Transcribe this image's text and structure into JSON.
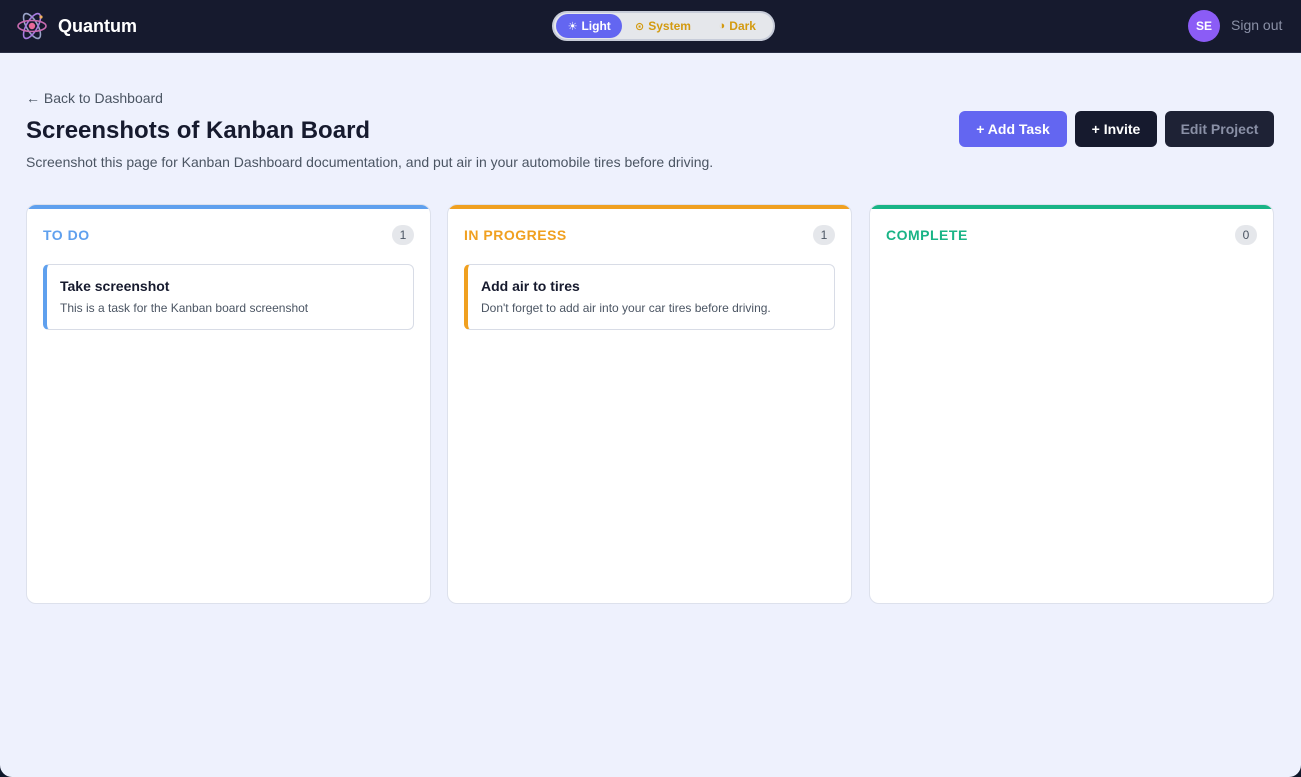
{
  "app": {
    "name": "Quantum",
    "user_initials": "SE",
    "sign_out": "Sign out"
  },
  "theme": {
    "options": [
      {
        "icon": "☀",
        "label": "Light",
        "icon_name": "sun-icon"
      },
      {
        "icon": "⊙",
        "label": "System",
        "icon_name": "monitor-icon"
      },
      {
        "icon": "◑",
        "label": "Dark",
        "icon_name": "contrast-icon"
      }
    ],
    "selected": "Light"
  },
  "page": {
    "back": "← Back to Dashboard",
    "title": "Screenshots of Kanban Board",
    "subtitle": "Screenshot this page for Kanban Dashboard documentation, and put air in your automobile tires before driving."
  },
  "actions": {
    "add_task": "+ Add Task",
    "invite": "+ Invite",
    "edit_project": "Edit Project"
  },
  "columns": [
    {
      "title": "TO DO",
      "count": "1",
      "color": "#5fa0ee",
      "cards": [
        {
          "title": "Take screenshot",
          "description": "This is a task for the Kanban board screenshot"
        }
      ]
    },
    {
      "title": "IN PROGRESS",
      "count": "1",
      "color": "#f0a020",
      "cards": [
        {
          "title": "Add air to tires",
          "description": "Don't forget to add air into your car tires before driving."
        }
      ]
    },
    {
      "title": "COMPLETE",
      "count": "0",
      "color": "#19b486",
      "cards": []
    }
  ],
  "colors": {
    "topbar": "#161a2e",
    "accent": "#6366f1",
    "background": "#eef1fd"
  }
}
